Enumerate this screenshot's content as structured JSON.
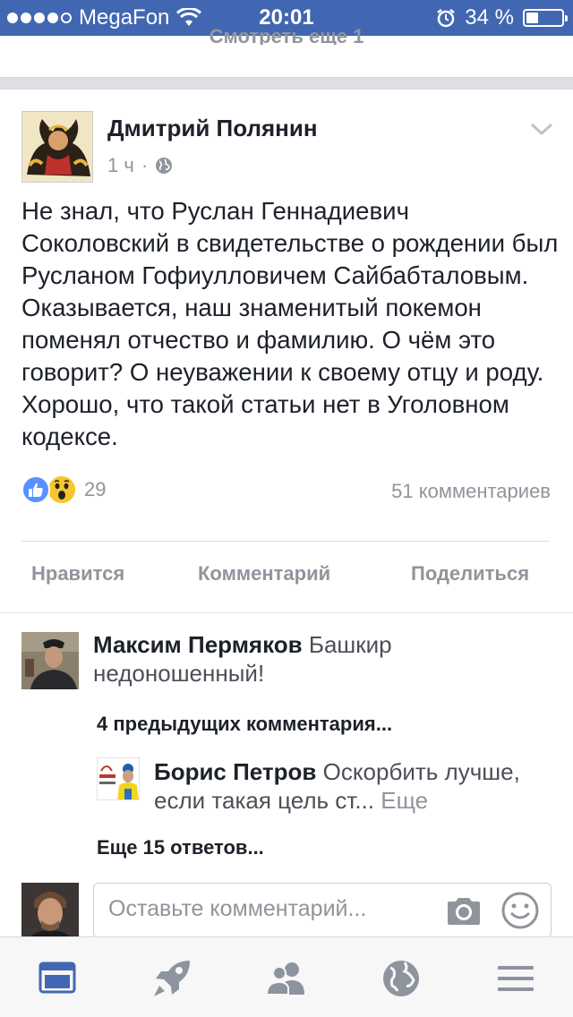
{
  "status_bar": {
    "carrier": "MegaFon",
    "time": "20:01",
    "battery_percent": "34 %",
    "signal_bars_filled": 4,
    "signal_bars_total": 5,
    "battery_level": 0.34
  },
  "feed": {
    "see_more_label": "Смотреть еще 1"
  },
  "post": {
    "author": "Дмитрий Полянин",
    "time": "1 ч",
    "separator": "·",
    "privacy_icon": "globe-icon",
    "text": "Не знал, что Руслан Геннадиевич Соколовский в свидетельстве о рождении был Русланом Гофиулловичем Сайбабталовым. Оказывается, наш знаменитый покемон поменял отчество и фамилию. О чём это говорит? О неуважении к своему отцу и роду. Хорошо, что такой статьи нет в Уголовном кодексе.",
    "reaction_count": "29",
    "reactions": [
      "like",
      "wow"
    ],
    "comments_count": "51 комментариев"
  },
  "actions": {
    "like": "Нравится",
    "comment": "Комментарий",
    "share": "Поделиться"
  },
  "comments": [
    {
      "author": "Максим Пермяков",
      "text": "Башкир недоношенный!"
    }
  ],
  "previous_comments_label": "4 предыдущих комментария...",
  "reply": {
    "author": "Борис Петров",
    "text": "Оскорбить лучше, если такая цель ст...",
    "more": "Еще"
  },
  "more_replies_label": "Еще 15 ответов...",
  "comment_box": {
    "placeholder": "Оставьте комментарий...",
    "camera_icon": "camera-icon",
    "emoji_icon": "smile-icon"
  },
  "tabbar": {
    "tabs": [
      "news-feed-icon",
      "rocket-icon",
      "friends-icon",
      "globe-icon",
      "menu-icon"
    ],
    "active": "news-feed-icon",
    "accent": "#4267b2",
    "inactive": "#8d949e"
  },
  "colors": {
    "brand": "#4267b2",
    "text": "#1d2129",
    "secondary": "#90949c",
    "like_blue": "#5890ff",
    "wow_yellow": "#f7c52d"
  }
}
